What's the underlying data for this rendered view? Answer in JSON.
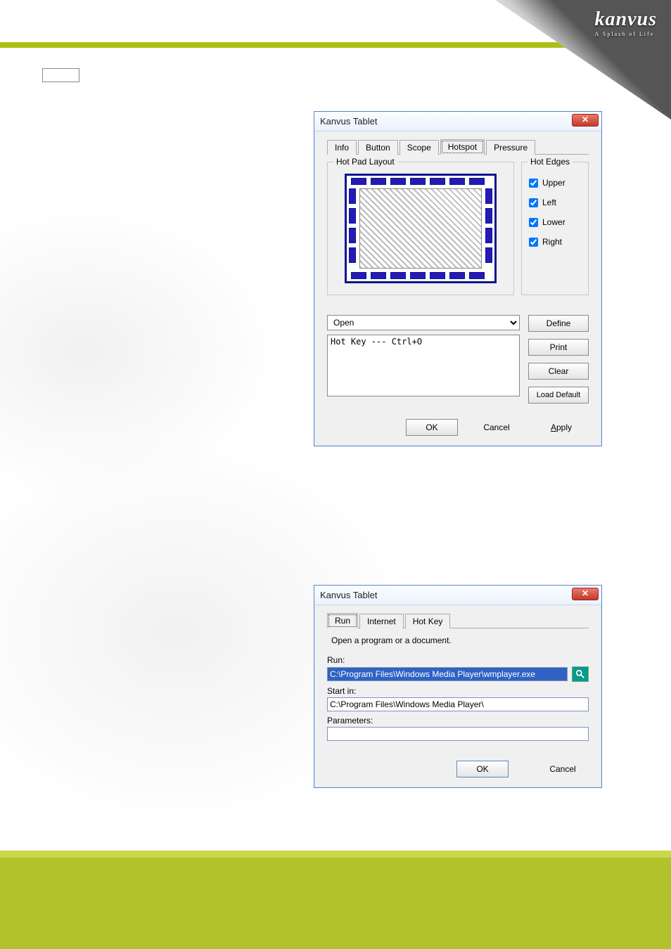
{
  "brand": {
    "name": "kanvus",
    "tagline": "A Splash of Life"
  },
  "dialog1": {
    "title": "Kanvus Tablet",
    "tabs": [
      "Info",
      "Button",
      "Scope",
      "Hotspot",
      "Pressure"
    ],
    "active_tab": "Hotspot",
    "hotpad_group": "Hot Pad Layout",
    "hotedges_group": "Hot Edges",
    "edges": [
      {
        "label": "Upper",
        "checked": true
      },
      {
        "label": "Left",
        "checked": true
      },
      {
        "label": "Lower",
        "checked": true
      },
      {
        "label": "Right",
        "checked": true
      }
    ],
    "combo_value": "Open",
    "hotkey_text": "Hot Key --- Ctrl+O",
    "buttons": {
      "define": "Define",
      "print": "Print",
      "clear": "Clear",
      "load_default": "Load Default"
    },
    "footer": {
      "ok": "OK",
      "cancel": "Cancel",
      "apply": "Apply"
    }
  },
  "dialog2": {
    "title": "Kanvus Tablet",
    "tabs": [
      "Run",
      "Internet",
      "Hot Key"
    ],
    "active_tab": "Run",
    "desc": "Open a program or a document.",
    "run_label": "Run:",
    "run_value": "C:\\Program Files\\Windows Media Player\\wmplayer.exe",
    "start_label": "Start in:",
    "start_value": "C:\\Program Files\\Windows Media Player\\",
    "params_label": "Parameters:",
    "params_value": "",
    "footer": {
      "ok": "OK",
      "cancel": "Cancel"
    }
  }
}
